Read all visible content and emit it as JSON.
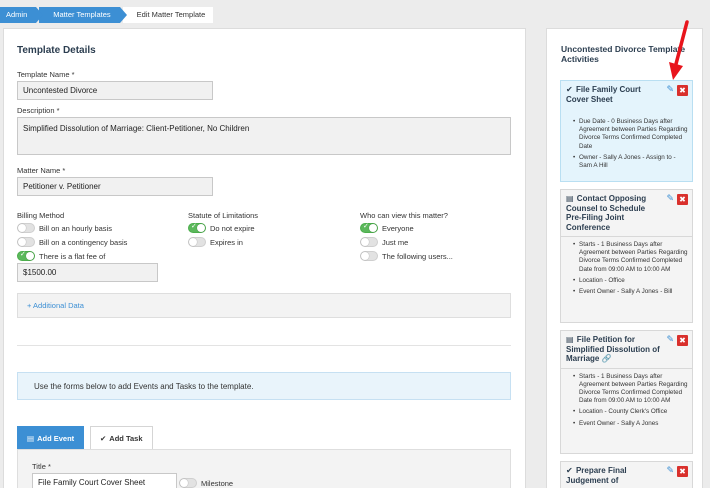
{
  "breadcrumb": [
    "Admin",
    "Matter Templates",
    "Edit Matter Template"
  ],
  "template_details": {
    "heading": "Template Details",
    "template_name_label": "Template Name *",
    "template_name_value": "Uncontested Divorce",
    "description_label": "Description *",
    "description_value": "Simplified Dissolution of Marriage:  Client-Petitioner, No Children",
    "matter_name_label": "Matter Name *",
    "matter_name_value": "Petitioner v. Petitioner"
  },
  "billing": {
    "label": "Billing Method",
    "options": [
      {
        "label": "Bill on an hourly basis",
        "on": false
      },
      {
        "label": "Bill on a contingency basis",
        "on": false
      },
      {
        "label": "There is a flat fee of",
        "on": true
      }
    ],
    "flat_fee_value": "$1500.00"
  },
  "statute": {
    "label": "Statute of Limitations",
    "options": [
      {
        "label": "Do not expire",
        "on": true
      },
      {
        "label": "Expires in",
        "on": false
      }
    ]
  },
  "visibility": {
    "label": "Who can view this matter?",
    "options": [
      {
        "label": "Everyone",
        "on": true
      },
      {
        "label": "Just me",
        "on": false
      },
      {
        "label": "The following users...",
        "on": false
      }
    ]
  },
  "additional_data": "+ Additional Data",
  "info_text": "Use the forms below to add Events and Tasks to the template.",
  "tabs": {
    "add_event": "Add Event",
    "add_task": "Add Task"
  },
  "task_form": {
    "title_label": "Title *",
    "title_value": "File Family Court Cover Sheet",
    "milestone_label": "Milestone"
  },
  "sidebar": {
    "title": "Uncontested Divorce Template Activities",
    "cards": [
      {
        "title": "File Family Court Cover Sheet",
        "kind_icon": "check-icon",
        "glyph": "✔",
        "items": [
          "Due Date - 0 Business Days after Agreement between Parties Regarding Divorce Terms Confirmed Completed Date",
          "Owner - Sally A Jones - Assign to - Sam A Hill"
        ]
      },
      {
        "title": "Contact Opposing Counsel to Schedule Pre-Filing Joint Conference",
        "kind_icon": "calendar-icon",
        "glyph": "▤",
        "items": [
          "Starts - 1 Business Days after Agreement between Parties Regarding Divorce Terms Confirmed Completed Date from 09:00 AM to 10:00 AM",
          "Location - Office",
          "Event Owner - Sally A Jones - Bill"
        ]
      },
      {
        "title": "File Petition for Simplified Dissolution of Marriage",
        "kind_icon": "calendar-icon",
        "glyph": "▤",
        "items": [
          "Starts - 1 Business Days after Agreement between Parties Regarding Divorce Terms Confirmed Completed Date from 09:00 AM to 10:00 AM",
          "Location - County Clerk's Office",
          "Event Owner - Sally A Jones"
        ]
      },
      {
        "title": "Prepare Final Judgement of",
        "kind_icon": "check-icon",
        "glyph": "✔",
        "items": []
      }
    ]
  },
  "colors": {
    "accent": "#3c8fd4",
    "toggle_on": "#5cb85c",
    "delete": "#d9302c",
    "arrow": "#e8141c"
  }
}
